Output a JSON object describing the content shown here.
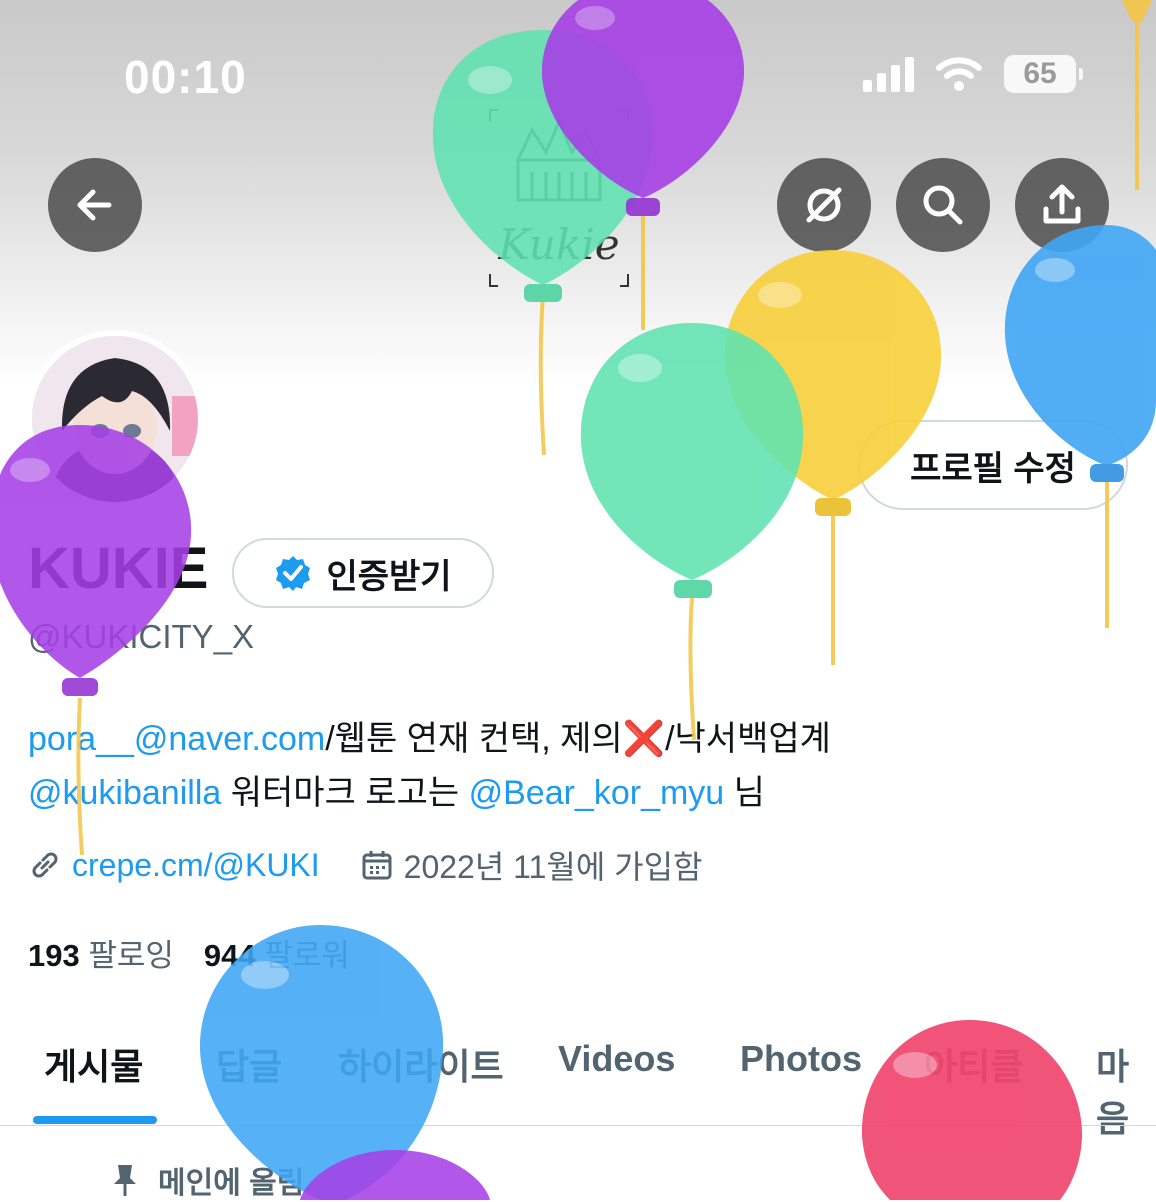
{
  "status_bar": {
    "time": "00:10",
    "battery": "65"
  },
  "header": {
    "logo_text": "Kukie",
    "back_icon": "arrow-left-icon",
    "actions": [
      "circle-slash-icon",
      "search-icon",
      "share-icon"
    ]
  },
  "profile": {
    "edit_label": "프로필 수정",
    "display_name": "KUKIE",
    "verify_label": "인증받기",
    "handle": "@KUKICITY_X",
    "bio_line1": {
      "email": "pora__@naver.com",
      "text_a": "/웹툰 연재 컨택, 제의",
      "emoji": "❌",
      "text_b": "/낙서백업계"
    },
    "bio_line2": {
      "mention1": "@kukibanilla",
      "text_a": " 워터마크 로고는 ",
      "mention2": "@Bear_kor_myu",
      "text_b": " 님"
    },
    "website": "crepe.cm/@KUKI",
    "joined": "2022년 11월에 가입함",
    "following_count": "193",
    "following_label": "팔로잉",
    "followers_count": "944",
    "followers_label": "팔로워"
  },
  "tabs": [
    {
      "label": "게시물",
      "active": true
    },
    {
      "label": "답글"
    },
    {
      "label": "하이라이트"
    },
    {
      "label": "Videos"
    },
    {
      "label": "Photos"
    },
    {
      "label": "아티클"
    },
    {
      "label": "마음"
    }
  ],
  "pinned_label": "메인에 올림",
  "colors": {
    "accent": "#1d9bf0",
    "balloon_green": "#5fe3b0",
    "balloon_purple": "#a640e6",
    "balloon_yellow": "#f8cf3a",
    "balloon_blue": "#3fa6f5",
    "balloon_pink": "#f0456e"
  }
}
